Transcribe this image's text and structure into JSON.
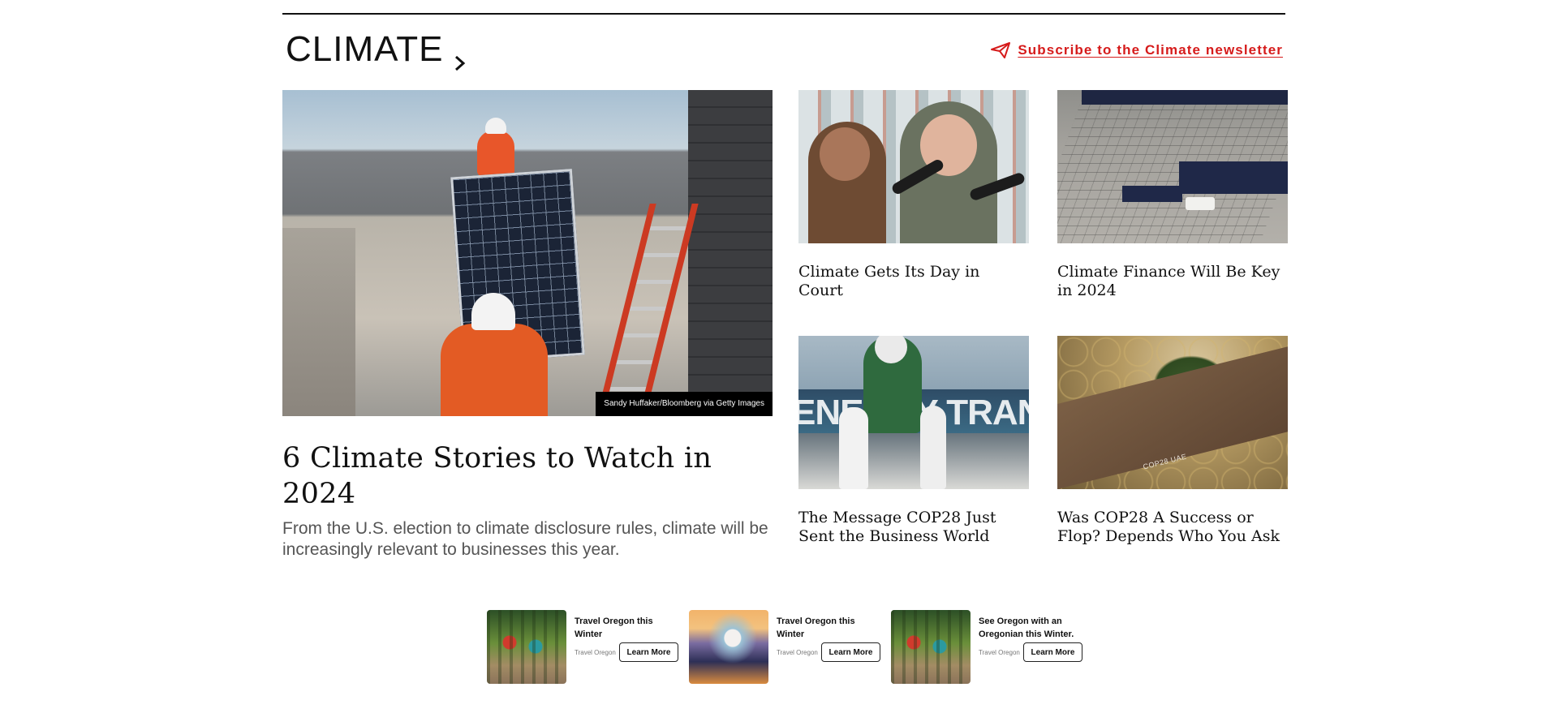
{
  "section": {
    "title": "CLIMATE",
    "subscribe_label": "Subscribe to the Climate newsletter",
    "accent_color": "#d61b1b",
    "icons": {
      "section_chevron": "chevron-right-icon",
      "subscribe": "send-icon"
    }
  },
  "feature": {
    "photo_credit": "Sandy Huffaker/Bloomberg via Getty Images",
    "headline": "6 Climate Stories to Watch in 2024",
    "dek": "From the U.S. election to climate disclosure rules, climate will be increasingly relevant to businesses this year."
  },
  "cards": [
    {
      "title": "Climate Gets Its Day in Court"
    },
    {
      "title": "Climate Finance Will Be Key in 2024"
    },
    {
      "title": "The Message COP28 Just Sent the Business World",
      "image_text": "ENERGY TRANSITION"
    },
    {
      "title": "Was COP28 A Success or Flop? Depends Who You Ask",
      "image_text": "COP28 UAE"
    }
  ],
  "ads": [
    {
      "title": "Travel Oregon this Winter",
      "source": "Travel Oregon",
      "button": "Learn More"
    },
    {
      "title": "Travel Oregon this Winter",
      "source": "Travel Oregon",
      "button": "Learn More"
    },
    {
      "title": "See Oregon with an Oregonian this Winter.",
      "source": "Travel Oregon",
      "button": "Learn More"
    }
  ]
}
